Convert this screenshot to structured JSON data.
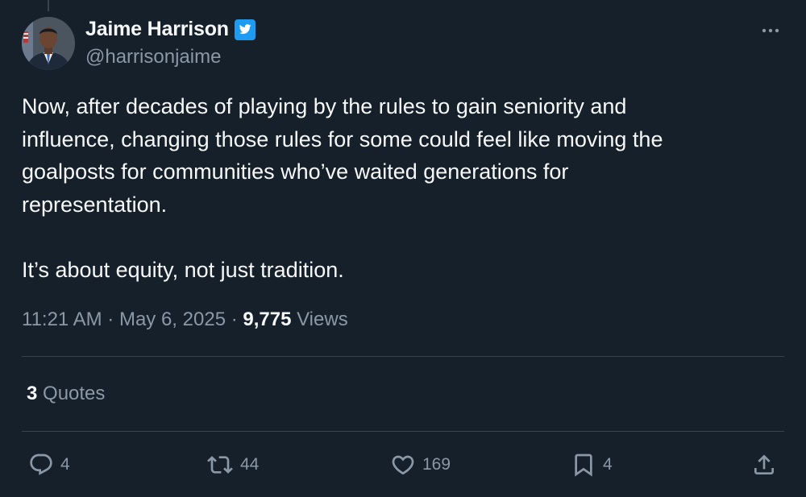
{
  "author": {
    "display_name": "Jaime Harrison",
    "handle": "@harrisonjaime",
    "verified": true
  },
  "tweet": {
    "text": "Now, after decades of playing by the rules to gain seniority and\ninfluence, changing those rules for some could feel like moving the\ngoalposts for communities who’ve waited generations for\nrepresentation.\n\nIt’s about equity, not just tradition.",
    "time": "11:21 AM",
    "separator": " · ",
    "date": "May 6, 2025",
    "views_count": "9,775",
    "views_label": " Views"
  },
  "quotes": {
    "count": "3",
    "label": " Quotes"
  },
  "actions": {
    "reply_count": "4",
    "retweet_count": "44",
    "like_count": "169",
    "bookmark_count": "4"
  },
  "icons": {
    "verified": "verified-badge-icon",
    "more": "more-options-icon",
    "reply": "reply-icon",
    "retweet": "retweet-icon",
    "like": "heart-icon",
    "bookmark": "bookmark-icon",
    "share": "share-icon"
  },
  "colors": {
    "background": "#15202b",
    "text_primary": "#f7f9f9",
    "text_secondary": "#8b98a5",
    "divider": "#38444d",
    "verified_blue": "#1d9bf0"
  }
}
